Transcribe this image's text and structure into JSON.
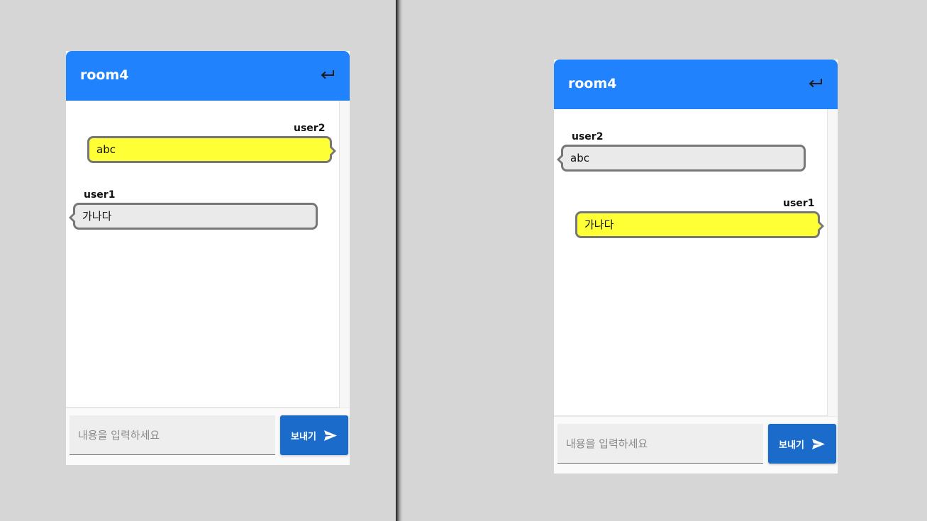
{
  "colors": {
    "background": "#d6d6d6",
    "header": "#2182fd",
    "send_button": "#1b6bcb",
    "my_bubble": "#ffff36",
    "other_bubble": "#eaeaea",
    "bubble_border": "#777777"
  },
  "icons": {
    "back": "return-arrow-icon",
    "send": "paper-plane-icon"
  },
  "panes": [
    {
      "room_title": "room4",
      "messages": [
        {
          "user": "user2",
          "text": "abc",
          "mine": true
        },
        {
          "user": "user1",
          "text": "가나다",
          "mine": false
        }
      ],
      "input": {
        "placeholder": "내용을 입력하세요",
        "value": ""
      },
      "send_label": "보내기"
    },
    {
      "room_title": "room4",
      "messages": [
        {
          "user": "user2",
          "text": "abc",
          "mine": false
        },
        {
          "user": "user1",
          "text": "가나다",
          "mine": true
        }
      ],
      "input": {
        "placeholder": "내용을 입력하세요",
        "value": ""
      },
      "send_label": "보내기"
    }
  ]
}
